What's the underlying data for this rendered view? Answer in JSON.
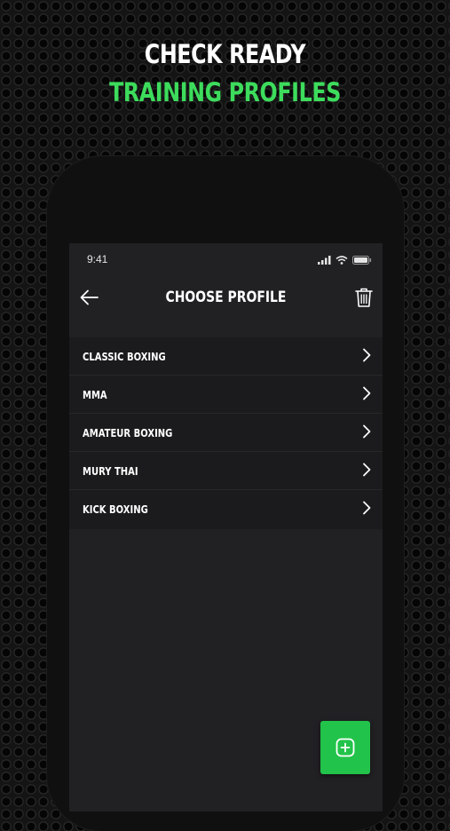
{
  "promo": {
    "line1": "CHECK READY",
    "line2": "TRAINING PROFILES"
  },
  "colors": {
    "accent": "#22c34a",
    "headline_green": "#3ddc5c",
    "screen_bg": "#212124",
    "list_bg": "#1b1b1d"
  },
  "status_bar": {
    "time": "9:41",
    "icons": [
      "signal-icon",
      "wifi-icon",
      "battery-icon"
    ]
  },
  "nav": {
    "title": "CHOOSE PROFILE",
    "back_icon": "arrow-left-icon",
    "delete_icon": "trash-icon"
  },
  "profiles": [
    {
      "label": "CLASSIC BOXING"
    },
    {
      "label": "MMA"
    },
    {
      "label": "AMATEUR BOXING"
    },
    {
      "label": "MURY THAI"
    },
    {
      "label": "KICK BOXING"
    }
  ],
  "fab": {
    "icon": "plus-square-icon"
  }
}
